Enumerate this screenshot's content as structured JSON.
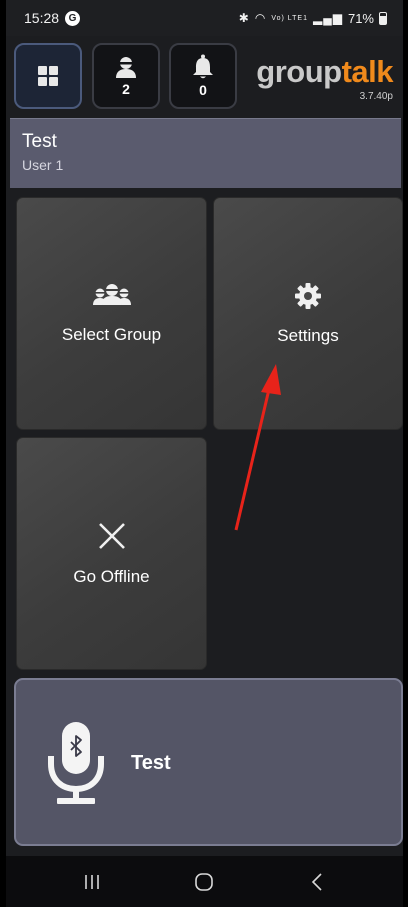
{
  "status_bar": {
    "time": "15:28",
    "notification_badge": "G",
    "indicators": "Vo) LTE1",
    "battery": "71%"
  },
  "app_bar": {
    "users_count": "2",
    "alerts_count": "0",
    "logo_group": "group",
    "logo_talk": "talk",
    "version": "3.7.40p"
  },
  "user": {
    "name": "Test",
    "sub": "User 1"
  },
  "tiles": {
    "select_group": "Select Group",
    "settings": "Settings",
    "go_offline": "Go Offline"
  },
  "ptt": {
    "label": "Test"
  },
  "colors": {
    "accent": "#f08a1c",
    "band": "#5a5b6e",
    "annotation": "#e8231a"
  },
  "icons": {
    "home": "grid-icon",
    "users": "user-icon",
    "alerts": "bell-icon",
    "select_group": "group-icon",
    "settings": "gear-icon",
    "offline": "close-icon",
    "ptt": "bluetooth-mic-icon"
  }
}
